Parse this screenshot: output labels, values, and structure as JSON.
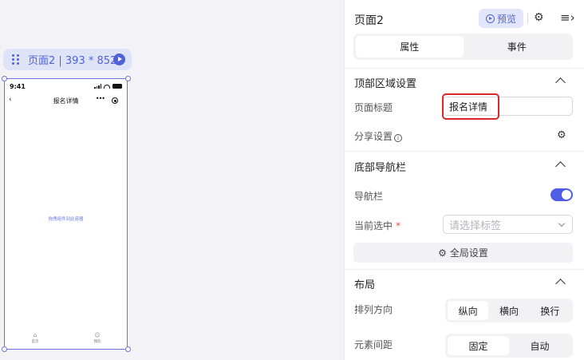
{
  "canvas": {
    "page_tag": "页面2 | 393 * 852",
    "phone": {
      "time": "9:41",
      "nav_title": "报名详情",
      "drop_hint": "拖拽组件到此容器",
      "tabs": [
        {
          "label": "首页",
          "icon": "home-icon"
        },
        {
          "label": "我的",
          "icon": "user-icon"
        }
      ]
    }
  },
  "panel": {
    "title": "页面2",
    "preview_label": "预览",
    "tabs": [
      {
        "label": "属性",
        "active": true
      },
      {
        "label": "事件",
        "active": false
      }
    ],
    "top_section": {
      "title": "顶部区域设置",
      "page_title_label": "页面标题",
      "page_title_value": "报名详情",
      "share_label": "分享设置"
    },
    "bottom_nav": {
      "title": "底部导航栏",
      "navbar_label": "导航栏",
      "navbar_enabled": true,
      "current_label": "当前选中",
      "required_mark": "*",
      "select_placeholder": "请选择标签",
      "global_settings": "全局设置"
    },
    "layout": {
      "title": "布局",
      "direction_label": "排列方向",
      "direction_options": [
        "纵向",
        "横向",
        "换行"
      ],
      "direction_selected": "纵向",
      "spacing_label": "元素间距",
      "spacing_options": [
        "固定",
        "自动"
      ],
      "spacing_selected": "固定"
    }
  },
  "colors": {
    "accent": "#4f5ee6",
    "highlight": "#d8282b"
  }
}
